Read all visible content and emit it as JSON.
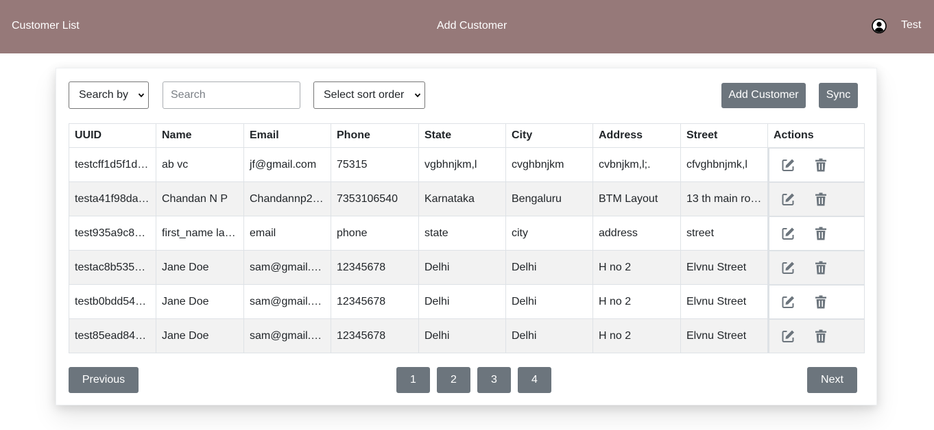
{
  "navbar": {
    "left_link": "Customer List",
    "center_link": "Add Customer",
    "user_name": "Test"
  },
  "toolbar": {
    "search_by": "Search by",
    "search_placeholder": "Search",
    "sort_order": "Select sort order",
    "add_customer_label": "Add Customer",
    "sync_label": "Sync"
  },
  "table": {
    "headers": [
      "UUID",
      "Name",
      "Email",
      "Phone",
      "State",
      "City",
      "Address",
      "Street",
      "Actions"
    ],
    "rows": [
      {
        "uuid": "testcff1d5f1d…",
        "name": "ab vc",
        "email": "jf@gmail.com",
        "phone": "75315",
        "state": "vgbhnjkm,l",
        "city": "cvghbnjkm",
        "address": "cvbnjkm,l;.",
        "street": "cfvghbnjmk,l"
      },
      {
        "uuid": "testa41f98da…",
        "name": "Chandan N P",
        "email": "Chandannp2…",
        "phone": "7353106540",
        "state": "Karnataka",
        "city": "Bengaluru",
        "address": "BTM Layout",
        "street": "13 th main ro…"
      },
      {
        "uuid": "test935a9c8…",
        "name": "first_name la…",
        "email": "email",
        "phone": "phone",
        "state": "state",
        "city": "city",
        "address": "address",
        "street": "street"
      },
      {
        "uuid": "testac8b535…",
        "name": "Jane Doe",
        "email": "sam@gmail.…",
        "phone": "12345678",
        "state": "Delhi",
        "city": "Delhi",
        "address": "H no 2",
        "street": "Elvnu Street"
      },
      {
        "uuid": "testb0bdd54…",
        "name": "Jane Doe",
        "email": "sam@gmail.…",
        "phone": "12345678",
        "state": "Delhi",
        "city": "Delhi",
        "address": "H no 2",
        "street": "Elvnu Street"
      },
      {
        "uuid": "test85ead84…",
        "name": "Jane Doe",
        "email": "sam@gmail.…",
        "phone": "12345678",
        "state": "Delhi",
        "city": "Delhi",
        "address": "H no 2",
        "street": "Elvnu Street"
      }
    ]
  },
  "pagination": {
    "previous_label": "Previous",
    "next_label": "Next",
    "pages": [
      "1",
      "2",
      "3",
      "4"
    ]
  },
  "colors": {
    "navbar_bg": "#967979",
    "button_bg": "#6c757d",
    "stripe_bg": "#f2f2f2"
  },
  "icons": {
    "user": "user-circle-icon",
    "edit": "edit-icon",
    "delete": "trash-icon"
  }
}
